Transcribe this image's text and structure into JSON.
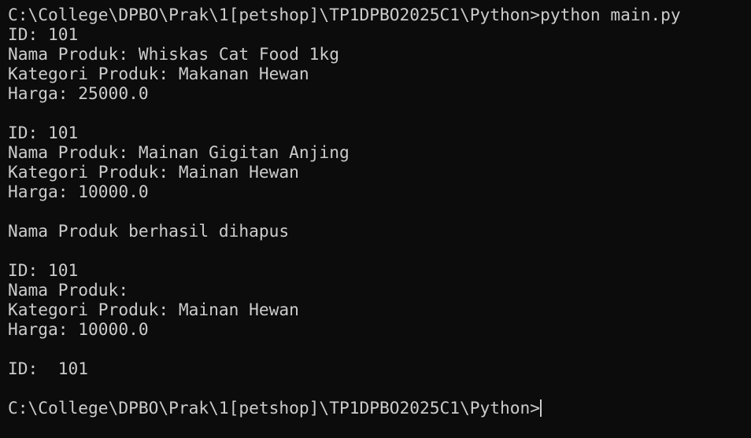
{
  "terminal": {
    "prompt": "C:\\College\\DPBO\\Prak\\1[petshop]\\TP1DPBO2025C1\\Python>",
    "command": "python main.py",
    "output": [
      "ID: 101",
      "Nama Produk: Whiskas Cat Food 1kg",
      "Kategori Produk: Makanan Hewan",
      "Harga: 25000.0",
      "",
      "ID: 101",
      "Nama Produk: Mainan Gigitan Anjing",
      "Kategori Produk: Mainan Hewan",
      "Harga: 10000.0",
      "",
      "Nama Produk berhasil dihapus",
      "",
      "ID: 101",
      "Nama Produk: ",
      "Kategori Produk: Mainan Hewan",
      "Harga: 10000.0",
      "",
      "ID:  101",
      ""
    ],
    "final_prompt": "C:\\College\\DPBO\\Prak\\1[petshop]\\TP1DPBO2025C1\\Python>"
  }
}
